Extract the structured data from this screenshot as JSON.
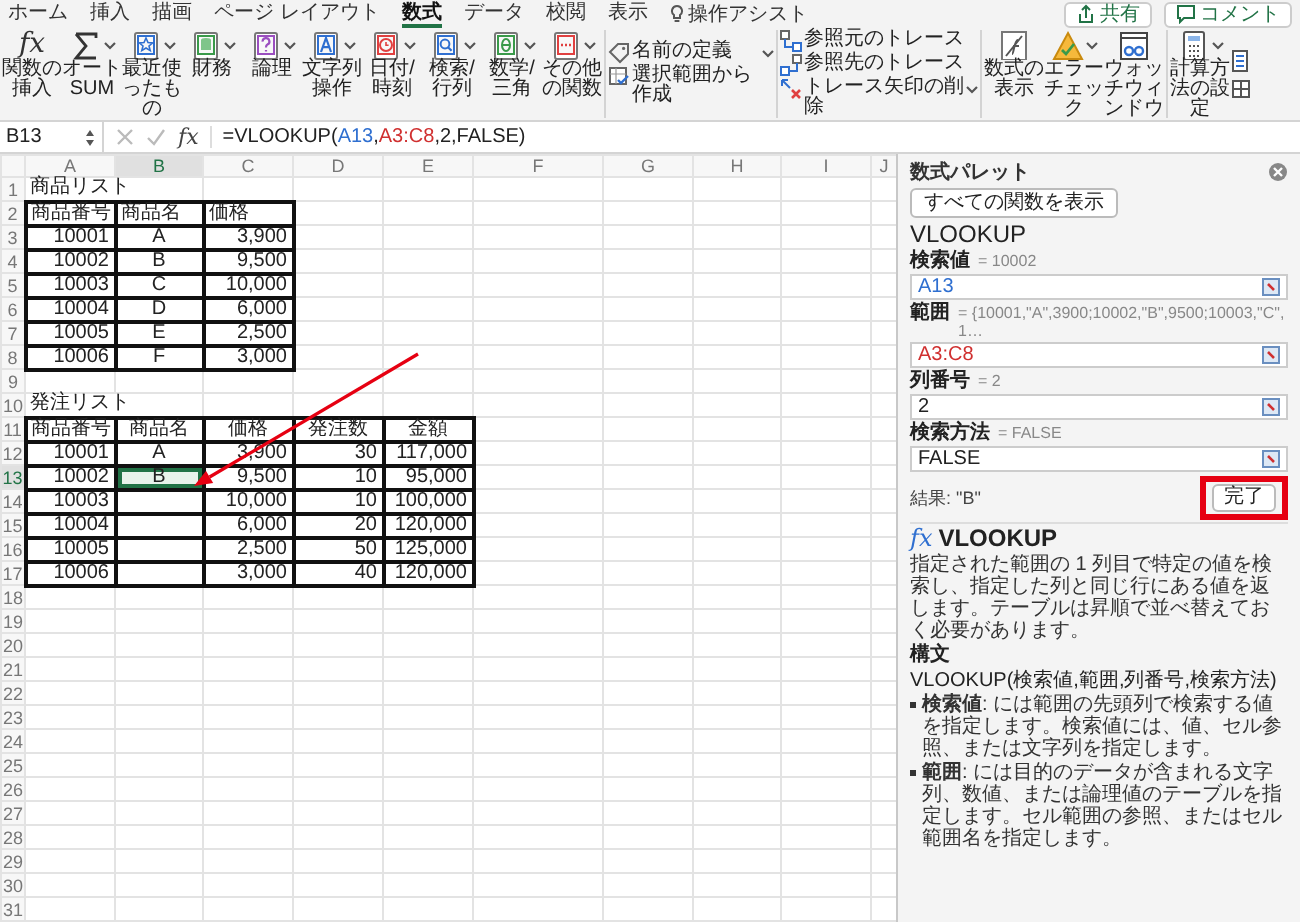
{
  "menu_tabs": [
    {
      "label": "ホーム",
      "selected": false
    },
    {
      "label": "挿入",
      "selected": false
    },
    {
      "label": "描画",
      "selected": false
    },
    {
      "label": "ページ レイアウト",
      "selected": false
    },
    {
      "label": "数式",
      "selected": true
    },
    {
      "label": "データ",
      "selected": false
    },
    {
      "label": "校閲",
      "selected": false
    },
    {
      "label": "表示",
      "selected": false
    }
  ],
  "assist": {
    "label": "操作アシスト"
  },
  "header_buttons": [
    {
      "label": "共有"
    },
    {
      "label": "コメント"
    }
  ],
  "ribbon": {
    "groups": [
      {
        "kind": "large",
        "items": [
          {
            "label": "関数の挿入",
            "glyph": "fx",
            "dropdown": false
          },
          {
            "label": "オート SUM",
            "dropdown": true
          },
          {
            "label": "最近使ったもの",
            "dropdown": true
          },
          {
            "label": "財務",
            "dropdown": true
          },
          {
            "label": "論理",
            "dropdown": true
          },
          {
            "label": "文字列操作",
            "dropdown": true
          },
          {
            "label": "日付/時刻",
            "dropdown": true
          },
          {
            "label": "検索/行列",
            "dropdown": true
          },
          {
            "label": "数学/三角",
            "dropdown": true
          },
          {
            "label": "その他の関数",
            "dropdown": true
          }
        ]
      },
      {
        "kind": "stack",
        "items": [
          {
            "label": "名前の定義",
            "dropdown": true
          },
          {
            "label": "選択範囲から作成",
            "dropdown": false
          }
        ]
      },
      {
        "kind": "stack",
        "items": [
          {
            "label": "参照元のトレース",
            "dropdown": false
          },
          {
            "label": "参照先のトレース",
            "dropdown": false
          },
          {
            "label": "トレース矢印の削除",
            "dropdown": true
          }
        ]
      },
      {
        "kind": "large",
        "items": [
          {
            "label": "数式の表示",
            "dropdown": false
          },
          {
            "label": "エラーチェック",
            "dropdown": true
          },
          {
            "label": "ウォッチウィンドウ",
            "dropdown": false
          }
        ]
      },
      {
        "kind": "large",
        "items": [
          {
            "label": "計算方法の設定",
            "dropdown": true
          }
        ]
      }
    ]
  },
  "formula_bar": {
    "cell_name": "B13",
    "fx": "fx",
    "formula": [
      {
        "text": "=VLOOKUP("
      },
      {
        "text": "A13",
        "color": "#2f6fd0"
      },
      {
        "text": ","
      },
      {
        "text": "A3:C8",
        "color": "#d03030"
      },
      {
        "text": ",2,FALSE)"
      }
    ]
  },
  "sheet": {
    "columns": [
      "A",
      "B",
      "C",
      "D",
      "E",
      "F",
      "G",
      "H",
      "I",
      "J"
    ],
    "rows": [
      {
        "number": "1",
        "cells": [
          {
            "kind": "text",
            "text": "商品リスト",
            "boxed": false,
            "selected": false
          }
        ]
      },
      {
        "number": "2",
        "cells": [
          {
            "kind": "text",
            "text": "商品番号",
            "boxed": true,
            "selected": false
          },
          {
            "kind": "text",
            "text": "商品名",
            "boxed": true,
            "selected": false
          },
          {
            "kind": "text",
            "text": "価格",
            "boxed": true,
            "selected": false
          }
        ]
      },
      {
        "number": "3",
        "cells": [
          {
            "kind": "number",
            "text": "10001",
            "boxed": true,
            "selected": false
          },
          {
            "kind": "code",
            "text": "A",
            "boxed": true,
            "selected": false
          },
          {
            "kind": "number",
            "text": "3,900",
            "boxed": true,
            "selected": false
          }
        ]
      },
      {
        "number": "4",
        "cells": [
          {
            "kind": "number",
            "text": "10002",
            "boxed": true,
            "selected": false
          },
          {
            "kind": "code",
            "text": "B",
            "boxed": true,
            "selected": false
          },
          {
            "kind": "number",
            "text": "9,500",
            "boxed": true,
            "selected": false
          }
        ]
      },
      {
        "number": "5",
        "cells": [
          {
            "kind": "number",
            "text": "10003",
            "boxed": true,
            "selected": false
          },
          {
            "kind": "code",
            "text": "C",
            "boxed": true,
            "selected": false
          },
          {
            "kind": "number",
            "text": "10,000",
            "boxed": true,
            "selected": false
          }
        ]
      },
      {
        "number": "6",
        "cells": [
          {
            "kind": "number",
            "text": "10004",
            "boxed": true,
            "selected": false
          },
          {
            "kind": "code",
            "text": "D",
            "boxed": true,
            "selected": false
          },
          {
            "kind": "number",
            "text": "6,000",
            "boxed": true,
            "selected": false
          }
        ]
      },
      {
        "number": "7",
        "cells": [
          {
            "kind": "number",
            "text": "10005",
            "boxed": true,
            "selected": false
          },
          {
            "kind": "code",
            "text": "E",
            "boxed": true,
            "selected": false
          },
          {
            "kind": "number",
            "text": "2,500",
            "boxed": true,
            "selected": false
          }
        ]
      },
      {
        "number": "8",
        "cells": [
          {
            "kind": "number",
            "text": "10006",
            "boxed": true,
            "selected": false
          },
          {
            "kind": "code",
            "text": "F",
            "boxed": true,
            "selected": false
          },
          {
            "kind": "number",
            "text": "3,000",
            "boxed": true,
            "selected": false
          }
        ]
      },
      {
        "number": "9"
      },
      {
        "number": "10",
        "cells": [
          {
            "kind": "text",
            "text": "発注リスト",
            "boxed": false,
            "selected": false
          }
        ]
      },
      {
        "number": "11",
        "cells": [
          {
            "kind": "header",
            "text": "商品番号",
            "boxed": true,
            "selected": false
          },
          {
            "kind": "header",
            "text": "商品名",
            "boxed": true,
            "selected": false
          },
          {
            "kind": "header",
            "text": "価格",
            "boxed": true,
            "selected": false
          },
          {
            "kind": "header",
            "text": "発注数",
            "boxed": true,
            "selected": false
          },
          {
            "kind": "header",
            "text": "金額",
            "boxed": true,
            "selected": false
          }
        ]
      },
      {
        "number": "12",
        "cells": [
          {
            "kind": "number",
            "text": "10001",
            "boxed": true,
            "selected": false
          },
          {
            "kind": "code",
            "text": "A",
            "boxed": true,
            "selected": false
          },
          {
            "kind": "number",
            "text": "3,900",
            "boxed": true,
            "selected": false
          },
          {
            "kind": "number",
            "text": "30",
            "boxed": true,
            "selected": false
          },
          {
            "kind": "number",
            "text": "117,000",
            "boxed": true,
            "selected": false
          }
        ]
      },
      {
        "number": "13",
        "cells": [
          {
            "kind": "number",
            "text": "10002",
            "boxed": true,
            "selected": false
          },
          {
            "kind": "code",
            "text": "B",
            "boxed": true,
            "selected": true
          },
          {
            "kind": "number",
            "text": "9,500",
            "boxed": true,
            "selected": false
          },
          {
            "kind": "number",
            "text": "10",
            "boxed": true,
            "selected": false
          },
          {
            "kind": "number",
            "text": "95,000",
            "boxed": true,
            "selected": false
          }
        ]
      },
      {
        "number": "14",
        "cells": [
          {
            "kind": "number",
            "text": "10003",
            "boxed": true,
            "selected": false
          },
          {
            "kind": "code",
            "boxed": true,
            "selected": false
          },
          {
            "kind": "number",
            "text": "10,000",
            "boxed": true,
            "selected": false
          },
          {
            "kind": "number",
            "text": "10",
            "boxed": true,
            "selected": false
          },
          {
            "kind": "number",
            "text": "100,000",
            "boxed": true,
            "selected": false
          }
        ]
      },
      {
        "number": "15",
        "cells": [
          {
            "kind": "number",
            "text": "10004",
            "boxed": true,
            "selected": false
          },
          {
            "kind": "code",
            "boxed": true,
            "selected": false
          },
          {
            "kind": "number",
            "text": "6,000",
            "boxed": true,
            "selected": false
          },
          {
            "kind": "number",
            "text": "20",
            "boxed": true,
            "selected": false
          },
          {
            "kind": "number",
            "text": "120,000",
            "boxed": true,
            "selected": false
          }
        ]
      },
      {
        "number": "16",
        "cells": [
          {
            "kind": "number",
            "text": "10005",
            "boxed": true,
            "selected": false
          },
          {
            "kind": "code",
            "boxed": true,
            "selected": false
          },
          {
            "kind": "number",
            "text": "2,500",
            "boxed": true,
            "selected": false
          },
          {
            "kind": "number",
            "text": "50",
            "boxed": true,
            "selected": false
          },
          {
            "kind": "number",
            "text": "125,000",
            "boxed": true,
            "selected": false
          }
        ]
      },
      {
        "number": "17",
        "cells": [
          {
            "kind": "number",
            "text": "10006",
            "boxed": true,
            "selected": false
          },
          {
            "kind": "code",
            "boxed": true,
            "selected": false
          },
          {
            "kind": "number",
            "text": "3,000",
            "boxed": true,
            "selected": false
          },
          {
            "kind": "number",
            "text": "40",
            "boxed": true,
            "selected": false
          },
          {
            "kind": "number",
            "text": "120,000",
            "boxed": true,
            "selected": false
          }
        ]
      },
      {
        "number": "18"
      },
      {
        "number": "19"
      },
      {
        "number": "20"
      },
      {
        "number": "21"
      },
      {
        "number": "22"
      },
      {
        "number": "23"
      },
      {
        "number": "24"
      },
      {
        "number": "25"
      },
      {
        "number": "26"
      },
      {
        "number": "27"
      },
      {
        "number": "28"
      },
      {
        "number": "29"
      },
      {
        "number": "30"
      },
      {
        "number": "31"
      }
    ]
  },
  "annotations": {
    "arrow": true,
    "highlight_frame": true
  },
  "palette": {
    "title": "数式パレット",
    "back_button": "すべての関数を表示",
    "function_name": "VLOOKUP",
    "arguments": [
      {
        "name": "検索値",
        "result": "= 10002",
        "value": "A13",
        "color": "#2f6fd0"
      },
      {
        "name": "範囲",
        "result": "= {10001,\"A\",3900;10002,\"B\",9500;10003,\"C\",1…",
        "value": "A3:C8",
        "color": "#d03030"
      },
      {
        "name": "列番号",
        "result": "= 2",
        "value": "2",
        "color": "#222222"
      },
      {
        "name": "検索方法",
        "result": "= FALSE",
        "value": "FALSE",
        "color": "#222222"
      }
    ],
    "result": "結果: \"B\"",
    "done_button": "完了",
    "help": {
      "glyph": "fx",
      "title": "VLOOKUP",
      "description": "指定された範囲の 1 列目で特定の値を検索し、指定した列と同じ行にある値を返します。テーブルは昇順で並べ替えておく必要があります。",
      "syntax_heading": "構文",
      "syntax": "VLOOKUP(検索値,範囲,列番号,検索方法)",
      "bullets": [
        "**検索値**: には範囲の先頭列で検索する値を指定します。検索値には、値、セル参照、または文字列を指定します。",
        "**範囲**: には目的のデータが含まれる文字列、数値、または論理値のテーブルを指定します。セル範囲の参照、またはセル範囲名を指定します。"
      ]
    }
  }
}
